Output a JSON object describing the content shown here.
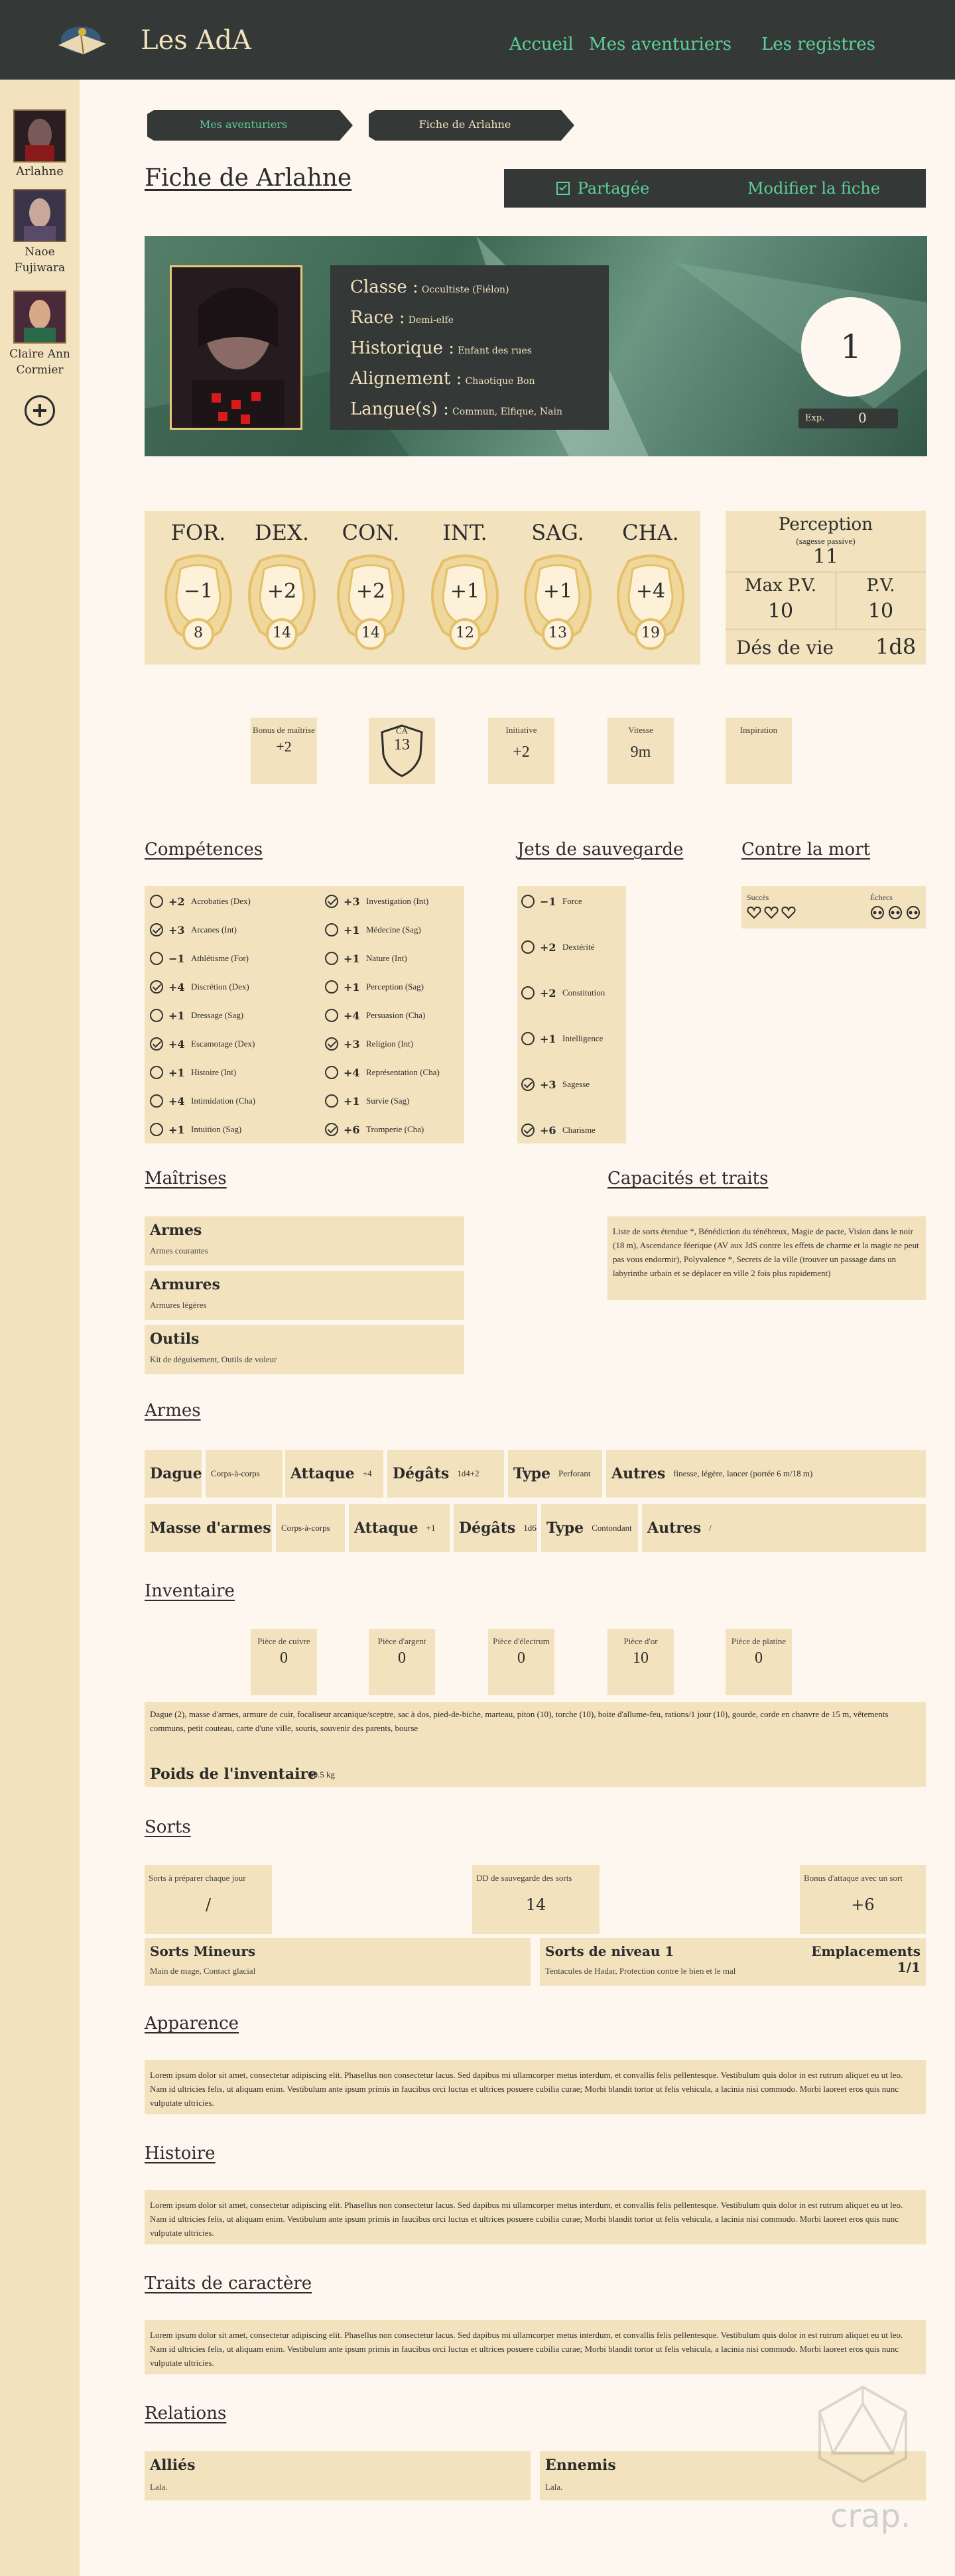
{
  "nav": {
    "brand": "Les AdA",
    "links": [
      "Accueil",
      "Mes aventuriers",
      "Les registres"
    ]
  },
  "sidebar": {
    "characters": [
      {
        "name": "Arlahne"
      },
      {
        "name": "Naoe Fujiwara"
      },
      {
        "name": "Claire Ann Cormier"
      }
    ],
    "add_icon": "plus-circle-icon"
  },
  "breadcrumb": [
    "Mes aventuriers",
    "Fiche de Arlahne"
  ],
  "page_title": "Fiche de Arlahne",
  "buttons": {
    "share": "Partagée",
    "edit": "Modifier la fiche"
  },
  "identity": {
    "classe_label": "Classe :",
    "classe": "Occultiste (Fiélon)",
    "race_label": "Race :",
    "race": "Demi-elfe",
    "historique_label": "Historique :",
    "historique": "Enfant des rues",
    "alignement_label": "Alignement :",
    "alignement": "Chaotique Bon",
    "langues_label": "Langue(s) :",
    "langues": "Commun, Elfique, Nain"
  },
  "level": "1",
  "exp": {
    "label": "Exp.",
    "value": "0"
  },
  "abilities": [
    {
      "abbr": "FOR.",
      "mod": "−1",
      "score": "8"
    },
    {
      "abbr": "DEX.",
      "mod": "+2",
      "score": "14"
    },
    {
      "abbr": "CON.",
      "mod": "+2",
      "score": "14"
    },
    {
      "abbr": "INT.",
      "mod": "+1",
      "score": "12"
    },
    {
      "abbr": "SAG.",
      "mod": "+1",
      "score": "13"
    },
    {
      "abbr": "CHA.",
      "mod": "+4",
      "score": "19"
    }
  ],
  "perception": {
    "title": "Perception",
    "sub": "(sagesse passive)",
    "value": "11"
  },
  "hp": {
    "max_label": "Max P.V.",
    "max": "10",
    "cur_label": "P.V.",
    "cur": "10"
  },
  "hit_dice": {
    "label": "Dés de vie",
    "value": "1d8"
  },
  "combat": {
    "prof_label": "Bonus de maîtrise",
    "prof": "+2",
    "ca_label": "CA",
    "ca": "13",
    "init_label": "Initiative",
    "init": "+2",
    "speed_label": "Vitesse",
    "speed": "9m",
    "insp_label": "Inspiration"
  },
  "sections": {
    "skills": "Compétences",
    "saves": "Jets de sauvegarde",
    "death": "Contre la mort",
    "prof": "Maîtrises",
    "traits": "Capacités et traits",
    "weapons": "Armes",
    "inventory": "Inventaire",
    "spells": "Sorts",
    "appearance": "Apparence",
    "history": "Histoire",
    "personality": "Traits de caractère",
    "relations": "Relations"
  },
  "skills_left": [
    {
      "on": false,
      "bonus": "+2",
      "name": "Acrobaties (Dex)"
    },
    {
      "on": true,
      "bonus": "+3",
      "name": "Arcanes (Int)"
    },
    {
      "on": false,
      "bonus": "−1",
      "name": "Athlétisme (For)"
    },
    {
      "on": true,
      "bonus": "+4",
      "name": "Discrétion (Dex)"
    },
    {
      "on": false,
      "bonus": "+1",
      "name": "Dressage (Sag)"
    },
    {
      "on": true,
      "bonus": "+4",
      "name": "Escamotage (Dex)"
    },
    {
      "on": false,
      "bonus": "+1",
      "name": "Histoire (Int)"
    },
    {
      "on": false,
      "bonus": "+4",
      "name": "Intimidation (Cha)"
    },
    {
      "on": false,
      "bonus": "+1",
      "name": "Intuition (Sag)"
    }
  ],
  "skills_right": [
    {
      "on": true,
      "bonus": "+3",
      "name": "Investigation (Int)"
    },
    {
      "on": false,
      "bonus": "+1",
      "name": "Médecine (Sag)"
    },
    {
      "on": false,
      "bonus": "+1",
      "name": "Nature (Int)"
    },
    {
      "on": false,
      "bonus": "+1",
      "name": "Perception (Sag)"
    },
    {
      "on": false,
      "bonus": "+4",
      "name": "Persuasion (Cha)"
    },
    {
      "on": true,
      "bonus": "+3",
      "name": "Religion (Int)"
    },
    {
      "on": false,
      "bonus": "+4",
      "name": "Représentation (Cha)"
    },
    {
      "on": false,
      "bonus": "+1",
      "name": "Survie (Sag)"
    },
    {
      "on": true,
      "bonus": "+6",
      "name": "Tromperie (Cha)"
    }
  ],
  "saves": [
    {
      "on": false,
      "bonus": "−1",
      "name": "Force"
    },
    {
      "on": false,
      "bonus": "+2",
      "name": "Dextérité"
    },
    {
      "on": false,
      "bonus": "+2",
      "name": "Constitution"
    },
    {
      "on": false,
      "bonus": "+1",
      "name": "Intelligence"
    },
    {
      "on": true,
      "bonus": "+3",
      "name": "Sagesse"
    },
    {
      "on": true,
      "bonus": "+6",
      "name": "Charisme"
    }
  ],
  "death": {
    "success_label": "Succès",
    "fail_label": "Échecs",
    "success_icon": "heart-icon",
    "fail_icon": "skull-icon"
  },
  "proficiencies": [
    {
      "title": "Armes",
      "text": "Armes courantes"
    },
    {
      "title": "Armures",
      "text": "Armures légères"
    },
    {
      "title": "Outils",
      "text": "Kit de déguisement, Outils de voleur"
    }
  ],
  "traits_text": "Liste de sorts étendue *, Bénédiction du ténébreux, Magie de pacte, Vision dans le noir (18 m), Ascendance féerique (AV aux JdS contre les effets de charme et la magie ne peut pas vous endormir), Polyvalence *, Secrets de la ville (trouver un passage dans un labyrinthe urbain et se déplacer en ville 2 fois plus rapidement)",
  "weapons": [
    {
      "name": "Dague",
      "kind": "Corps-à-corps",
      "atk_label": "Attaque",
      "atk": "+4",
      "dmg_label": "Dégâts",
      "dmg": "1d4+2",
      "type_label": "Type",
      "type": "Perforant",
      "other_label": "Autres",
      "other": "finesse, légère, lancer (portée 6 m/18 m)"
    },
    {
      "name": "Masse d'armes",
      "kind": "Corps-à-corps",
      "atk_label": "Attaque",
      "atk": "+1",
      "dmg_label": "Dégâts",
      "dmg": "1d6-1",
      "type_label": "Type",
      "type": "Contondant",
      "other_label": "Autres",
      "other": "/"
    }
  ],
  "coins": [
    {
      "label": "Pièce de cuivre",
      "value": "0"
    },
    {
      "label": "Pièce d'argent",
      "value": "0"
    },
    {
      "label": "Pièce d'électrum",
      "value": "0"
    },
    {
      "label": "Pièce d'or",
      "value": "10"
    },
    {
      "label": "Pièce de platine",
      "value": "0"
    }
  ],
  "inventory_text": "Dague (2), masse d'armes, armure de cuir, focaliseur arcanique/sceptre,  sac à dos, pied-de-biche, marteau, piton (10), torche (10), boite  d'allume-feu, rations/1 jour (10), gourde, corde en chanvre de 15 m,  vêtements communs, petit couteau, carte d'une ville, souris, souvenir  des parents, bourse",
  "weight": {
    "label": "Poids de l'inventaire",
    "value": "40.5 kg"
  },
  "spells": {
    "prep_label": "Sorts à préparer chaque jour",
    "prep": "/",
    "dc_label": "DD de sauvegarde des sorts",
    "dc": "14",
    "atk_label": "Bonus d'attaque avec un sort",
    "atk": "+6",
    "minor_title": "Sorts Mineurs",
    "minor": "Main de mage, Contact glacial",
    "lvl1_title": "Sorts de niveau 1",
    "slots_label": "Emplacements 1/1",
    "lvl1": "Tentacules de Hadar, Protection contre le bien et le mal"
  },
  "lorem": "Lorem ipsum dolor sit amet, consectetur adipiscing elit. Phasellus non  consectetur lacus. Sed dapibus mi ullamcorper metus interdum, et  convallis felis pellentesque. Vestibulum quis dolor in est rutrum  aliquet eu ut leo. Nam id ultricies felis, ut aliquam enim. Vestibulum  ante ipsum primis in faucibus orci luctus et ultrices posuere cubilia  curae; Morbi blandit tortor ut felis vehicula, a lacinia nisi commodo.  Morbi laoreet eros quis nunc vulputate ultricies.",
  "relations": [
    {
      "title": "Alliés",
      "text": "Lala."
    },
    {
      "title": "Ennemis",
      "text": "Lala."
    }
  ],
  "watermark": "crap.",
  "colors": {
    "dark": "#343837",
    "tan": "#f3e2be",
    "accent": "#5ecf9a",
    "bg": "#fdf7ef",
    "banner": "#3f6e58"
  }
}
